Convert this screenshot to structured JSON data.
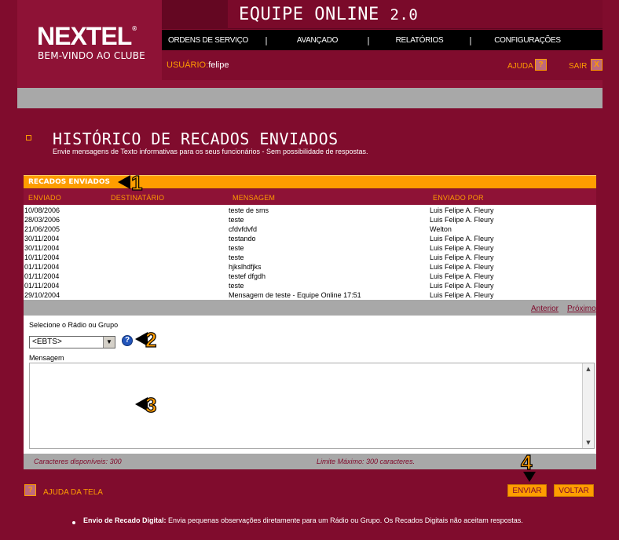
{
  "brand": {
    "logo_text": "NEXTEL",
    "logo_reg": "®",
    "tagline": "BEM-VINDO AO CLUBE"
  },
  "app": {
    "title": "EQUIPE ONLINE",
    "version": "2.0"
  },
  "nav": {
    "items": [
      "ORDENS DE SERVIÇO",
      "AVANÇADO",
      "RELATÓRIOS",
      "CONFIGURAÇÕES"
    ],
    "separator": "|"
  },
  "user": {
    "label": "USUÁRIO:",
    "name": "felipe"
  },
  "header_actions": {
    "help_label": "AJUDA",
    "help_icon": "?",
    "exit_label": "SAIR",
    "exit_icon": "X"
  },
  "page": {
    "title": "HISTÓRICO DE RECADOS ENVIADOS",
    "subtitle": "Envie mensagens de Texto informativas para os seus funcionários - Sem possibilidade de respostas."
  },
  "panel": {
    "header": "RECADOS ENVIADOS",
    "columns": [
      "ENVIADO",
      "DESTINATÁRIO",
      "MENSAGEM",
      "ENVIADO POR"
    ],
    "rows": [
      {
        "date": "10/08/2006",
        "recipient": "",
        "message": "teste de sms",
        "sender": "Luis Felipe A. Fleury"
      },
      {
        "date": "28/03/2006",
        "recipient": "",
        "message": "teste",
        "sender": "Luis Felipe A. Fleury"
      },
      {
        "date": "21/06/2005",
        "recipient": "",
        "message": "cfdvfdvfd",
        "sender": "Welton"
      },
      {
        "date": "30/11/2004",
        "recipient": "",
        "message": "testando",
        "sender": "Luis Felipe A. Fleury"
      },
      {
        "date": "30/11/2004",
        "recipient": "",
        "message": "teste",
        "sender": "Luis Felipe A. Fleury"
      },
      {
        "date": "10/11/2004",
        "recipient": "",
        "message": "teste",
        "sender": "Luis Felipe A. Fleury"
      },
      {
        "date": "01/11/2004",
        "recipient": "",
        "message": "hjkslhdfjks",
        "sender": "Luis Felipe A. Fleury"
      },
      {
        "date": "01/11/2004",
        "recipient": "",
        "message": "testef dfgdh",
        "sender": "Luis Felipe A. Fleury"
      },
      {
        "date": "01/11/2004",
        "recipient": "",
        "message": "teste",
        "sender": "Luis Felipe A. Fleury"
      },
      {
        "date": "29/10/2004",
        "recipient": "",
        "message": "Mensagem de teste - Equipe Online 17:51",
        "sender": "Luis Felipe A. Fleury"
      }
    ],
    "pager": {
      "previous": "Anterior",
      "next": "Próximo"
    }
  },
  "form": {
    "select_label": "Selecione o Rádio ou Grupo",
    "select_value": "<EBTS>",
    "select_help_icon": "?",
    "message_label": "Mensagem",
    "message_value": "",
    "chars_available_label": "Caracteres disponíveis:",
    "chars_available_value": "300",
    "max_limit_label": "Limite Máximo:",
    "max_limit_value": "300 caracteres."
  },
  "bottom": {
    "help_icon": "?",
    "help_screen_label": "AJUDA DA TELA",
    "send_button": "ENVIAR",
    "back_button": "VOLTAR"
  },
  "info": {
    "title": "Envio de Recado Digital:",
    "text": "Envia pequenas observações diretamente para um Rádio ou Grupo. Os Recados Digitais não aceitam respostas."
  },
  "callouts": [
    "1",
    "2",
    "3",
    "4"
  ],
  "colors": {
    "background": "#800c2d",
    "accent": "#ff9d00",
    "nav_bg": "#000000",
    "gray": "#a8a8a8"
  }
}
